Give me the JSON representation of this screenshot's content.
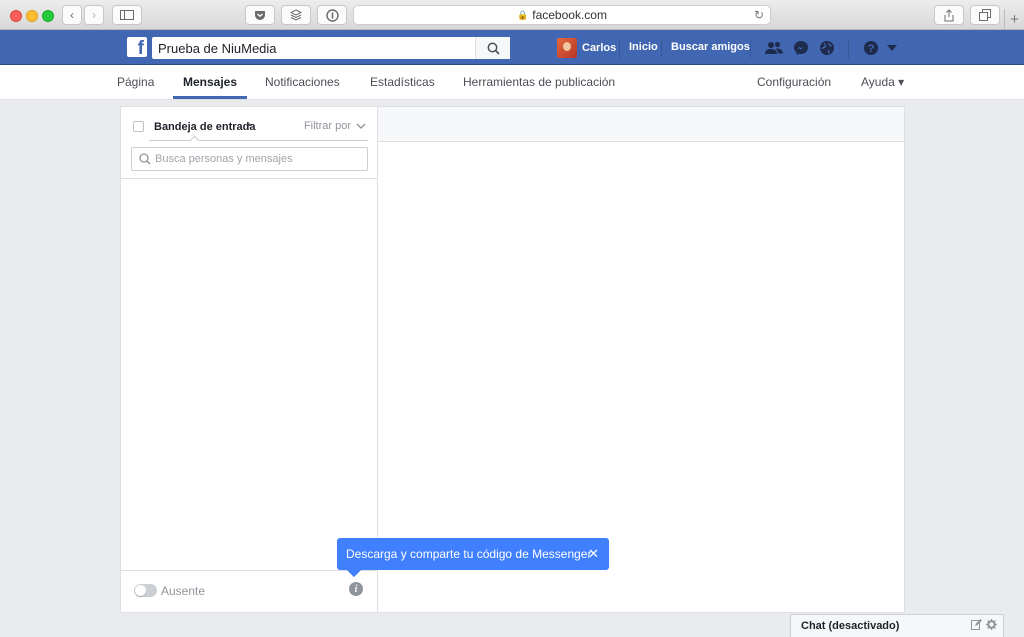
{
  "browser": {
    "url": "facebook.com",
    "lock_glyph": "🔒",
    "reload_glyph": "↻",
    "new_tab_glyph": "+",
    "buttons": {
      "back": "‹",
      "forward": "›"
    }
  },
  "fb_header": {
    "logo_letter": "f",
    "search_value": "Prueba de NiuMedia",
    "user_name": "Carlos",
    "home_label": "Inicio",
    "find_friends_label": "Buscar amigos",
    "icons": [
      "friends-icon",
      "messenger-icon",
      "globe-icon",
      "help-icon",
      "caret-down-icon"
    ]
  },
  "page_nav": {
    "tabs": [
      {
        "label": "Página",
        "active": false
      },
      {
        "label": "Mensajes",
        "active": true
      },
      {
        "label": "Notificaciones",
        "active": false
      },
      {
        "label": "Estadísticas",
        "active": false
      },
      {
        "label": "Herramientas de publicación",
        "active": false
      }
    ],
    "settings_label": "Configuración",
    "help_label": "Ayuda ▾"
  },
  "inbox": {
    "title": "Bandeja de entrada",
    "dot": "•",
    "filter_label": "Filtrar por",
    "search_placeholder": "Busca personas y mensajes",
    "away_label": "Ausente",
    "info_glyph": "i"
  },
  "tooltip": {
    "text": "Descarga y comparte tu código de Messenger",
    "close_glyph": "✕"
  },
  "chat": {
    "label": "Chat (desactivado)"
  },
  "colors": {
    "fb_blue": "#4267b2",
    "tooltip_blue": "#4080ff",
    "page_bg": "#e9ebee"
  }
}
